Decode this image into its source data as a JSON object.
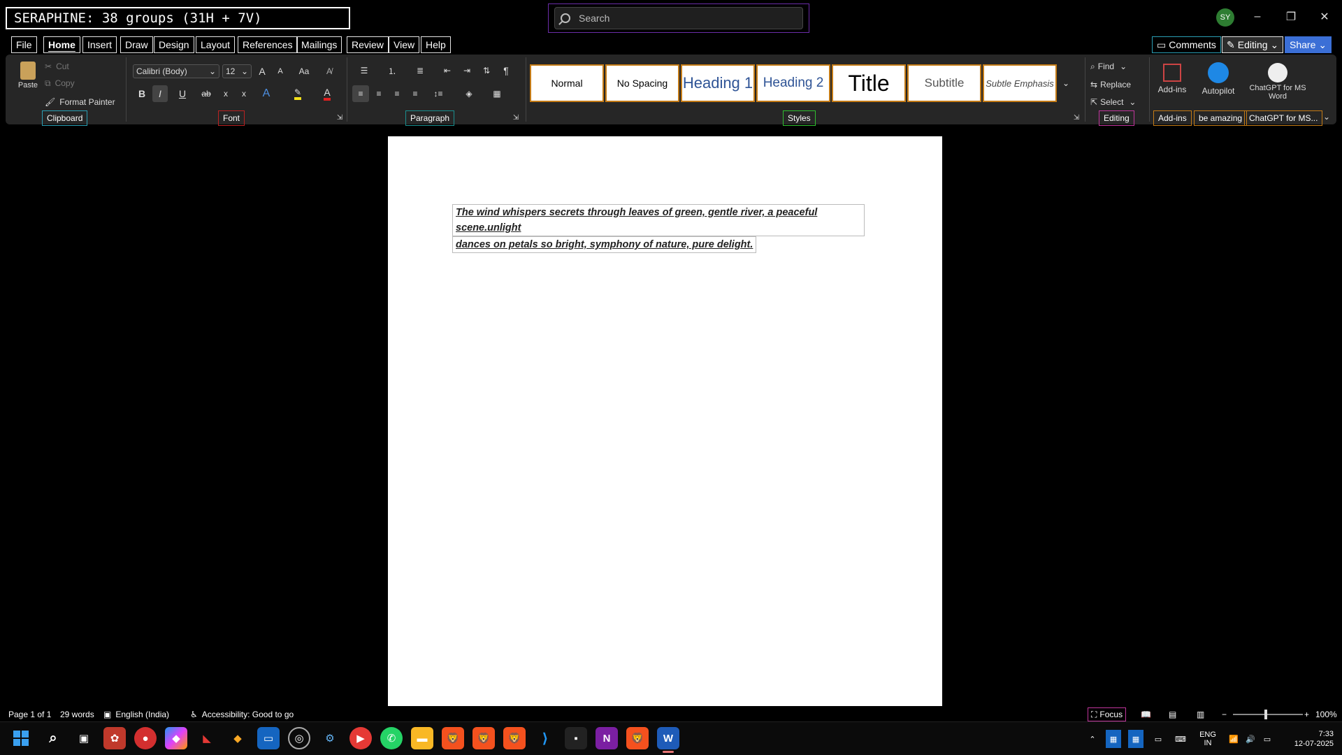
{
  "banner": {
    "text": "SERAPHINE: 38 groups (31H + 7V)"
  },
  "search": {
    "placeholder": "Search"
  },
  "titlebar": {
    "avatar_initials": "SY",
    "minimize": "–",
    "restore": "❐",
    "close": "✕"
  },
  "menu": {
    "tabs": [
      "File",
      "Home",
      "Insert",
      "Draw",
      "Design",
      "Layout",
      "References",
      "Mailings",
      "Review",
      "View",
      "Help"
    ],
    "active": "Home",
    "comments": "Comments",
    "editing_mode": "Editing",
    "share": "Share"
  },
  "clipboard": {
    "paste": "Paste",
    "cut": "Cut",
    "copy": "Copy",
    "format_painter": "Format Painter",
    "label": "Clipboard"
  },
  "font": {
    "family": "Calibri (Body)",
    "size": "12",
    "grow": "A",
    "shrink": "A",
    "case": "Aa",
    "bold": "B",
    "italic": "I",
    "underline": "U",
    "strike": "ab",
    "subscript": "x",
    "superscript": "x",
    "label": "Font"
  },
  "paragraph": {
    "label": "Paragraph"
  },
  "styles": {
    "items": [
      "Normal",
      "No Spacing",
      "Heading 1",
      "Heading 2",
      "Title",
      "Subtitle",
      "Subtle Emphasis"
    ],
    "label": "Styles"
  },
  "editing": {
    "find": "Find",
    "replace": "Replace",
    "select": "Select",
    "label": "Editing"
  },
  "addins": {
    "addins": "Add-ins",
    "autopilot": "Autopilot",
    "chatgpt": "ChatGPT for MS Word",
    "label_addins": "Add-ins",
    "label_amazing": "be amazing",
    "label_chatgpt": "ChatGPT for MS..."
  },
  "document": {
    "line1": "The wind whispers secrets through leaves of green, gentle river, a peaceful scene.unlight",
    "line2": "dances on petals so bright, symphony of nature, pure delight."
  },
  "status": {
    "page": "Page 1 of 1",
    "words": "29 words",
    "language": "English (India)",
    "accessibility": "Accessibility: Good to go",
    "focus": "Focus",
    "zoom": "100%"
  },
  "taskbar": {
    "apps": [
      "start-icon",
      "search-icon",
      "task-view-icon",
      "app-icon-1",
      "app-icon-2",
      "copilot-icon",
      "app-icon-3",
      "app-icon-4",
      "app-icon-5",
      "chrome-icon",
      "app-icon-6",
      "youtube-icon",
      "whatsapp-icon",
      "file-explorer-icon",
      "brave-icon",
      "brave-icon-2",
      "brave-icon-3",
      "vscode-icon",
      "app-icon-7",
      "onenote-icon",
      "brave-icon-4",
      "word-icon"
    ],
    "lang_top": "ENG",
    "lang_bottom": "IN",
    "time": "7:33",
    "date": "12-07-2025"
  }
}
